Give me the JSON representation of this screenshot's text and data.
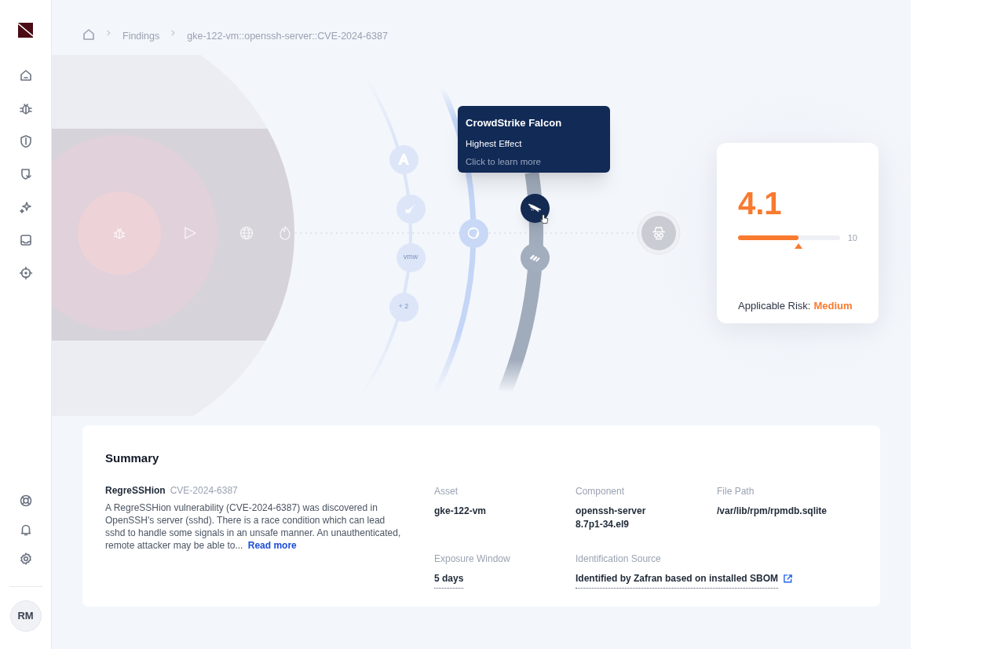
{
  "breadcrumb": [
    "Findings",
    "gke-122-vm::openssh-server::CVE-2024-6387"
  ],
  "user": {
    "initials": "RM"
  },
  "diagram": {
    "nodes": [
      {
        "kind": "logo-a",
        "selected": false
      },
      {
        "kind": "logo-check",
        "selected": false
      },
      {
        "kind": "text",
        "label": "vmw",
        "selected": false
      },
      {
        "kind": "text",
        "label": "+ 2",
        "selected": false
      },
      {
        "kind": "logo-ring",
        "selected": false
      },
      {
        "kind": "logo-falcon",
        "selected": true
      },
      {
        "kind": "logo-stripes",
        "selected": false
      }
    ],
    "tooltip": {
      "title": "CrowdStrike Falcon",
      "subtitle": "Highest Effect",
      "hint": "Click to learn more"
    }
  },
  "risk": {
    "score": "4.1",
    "level": 0.59,
    "max": "10",
    "label": "Applicable Risk:",
    "value": "Medium"
  },
  "summary": {
    "title": "Summary",
    "name": "RegreSSHion",
    "cve": "CVE-2024-6387",
    "description": "A RegreSSHion vulnerability (CVE-2024-6387) was discovered in OpenSSH's server (sshd). There is a race condition which can lead sshd to handle some signals in an unsafe manner. An unauthenticated, remote attacker may be able to...",
    "read_more": "Read more",
    "fields": [
      {
        "kind": "text",
        "label": "Asset",
        "value": [
          "gke-122-vm"
        ],
        "underlined": false
      },
      {
        "kind": "text",
        "label": "Component",
        "value": [
          "openssh-server",
          "8.7p1-34.el9"
        ],
        "underlined": false
      },
      {
        "kind": "text",
        "label": "File Path",
        "value": [
          "/var/lib/rpm/rpmdb.sqlite"
        ],
        "underlined": false
      },
      {
        "kind": "text",
        "label": "Exposure Window",
        "value": [
          "5 days"
        ],
        "underlined": true
      },
      {
        "kind": "link",
        "label": "Identification Source",
        "value": [
          "Identified by Zafran based on installed SBOM"
        ],
        "underlined": true
      }
    ]
  }
}
